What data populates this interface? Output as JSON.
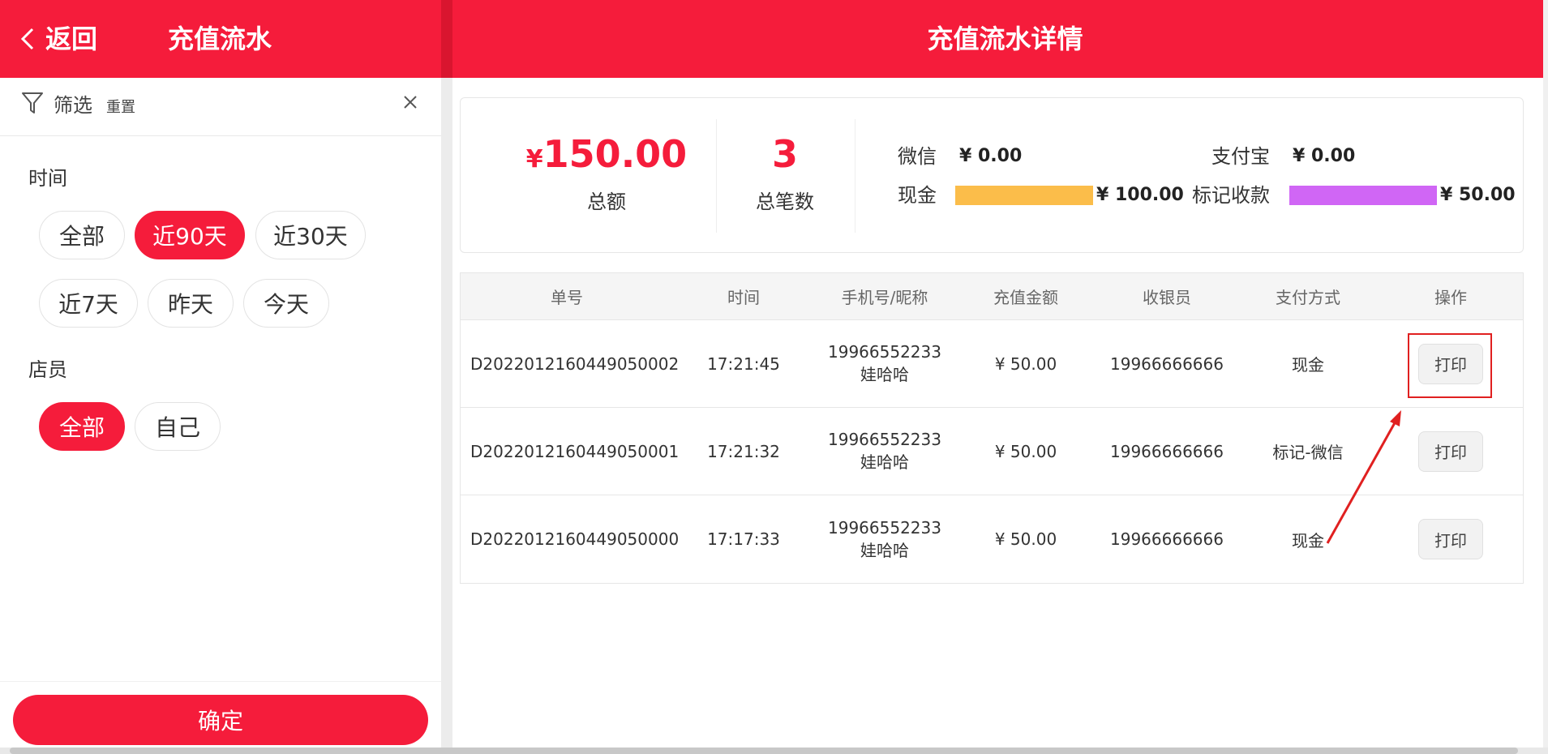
{
  "left": {
    "back_label": "返回",
    "title": "充值流水",
    "filter_label": "筛选",
    "reset_label": "重置",
    "time_section": "时间",
    "time_options": [
      "全部",
      "近90天",
      "近30天",
      "近7天",
      "昨天",
      "今天"
    ],
    "time_selected": "近90天",
    "staff_section": "店员",
    "staff_options": [
      "全部",
      "自己"
    ],
    "staff_selected": "全部",
    "confirm_label": "确定"
  },
  "right": {
    "title": "充值流水详情",
    "summary": {
      "currency": "¥",
      "total_amount": "150.00",
      "total_amount_label": "总额",
      "total_count": "3",
      "total_count_label": "总笔数",
      "payments": [
        {
          "name": "微信",
          "value": "¥ 0.00"
        },
        {
          "name": "支付宝",
          "value": "¥ 0.00"
        },
        {
          "name": "现金",
          "value": "¥ 100.00",
          "color": "#fbbd4a"
        },
        {
          "name": "标记收款",
          "value": "¥ 50.00",
          "color": "#d066f5"
        }
      ]
    },
    "table": {
      "headers": [
        "单号",
        "时间",
        "手机号/昵称",
        "充值金额",
        "收银员",
        "支付方式",
        "操作"
      ],
      "rows": [
        {
          "order": "D2022012160449050002",
          "time": "17:21:45",
          "phone": "19966552233",
          "nickname": "娃哈哈",
          "amount": "¥ 50.00",
          "cashier": "19966666666",
          "method": "现金",
          "action": "打印"
        },
        {
          "order": "D2022012160449050001",
          "time": "17:21:32",
          "phone": "19966552233",
          "nickname": "娃哈哈",
          "amount": "¥ 50.00",
          "cashier": "19966666666",
          "method": "标记-微信",
          "action": "打印"
        },
        {
          "order": "D2022012160449050000",
          "time": "17:17:33",
          "phone": "19966552233",
          "nickname": "娃哈哈",
          "amount": "¥ 50.00",
          "cashier": "19966666666",
          "method": "现金",
          "action": "打印"
        }
      ]
    }
  },
  "colors": {
    "brand_red": "#f51c3b",
    "cash_bar": "#fbbd4a",
    "marked_bar": "#d066f5",
    "annotation_red": "#e02020"
  }
}
